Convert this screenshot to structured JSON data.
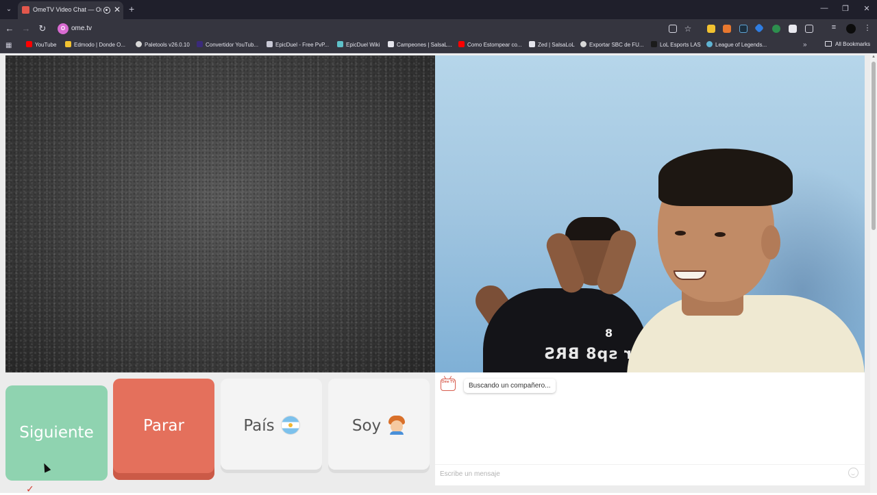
{
  "browser": {
    "tab_title": "OmeTV Video Chat — Ome",
    "tab_close": "✕",
    "new_tab": "+",
    "url": "ome.tv",
    "site_icon_letter": "O",
    "window": {
      "minimize": "—",
      "restore": "❐",
      "close": "✕"
    },
    "nav": {
      "back": "←",
      "forward": "→",
      "reload": "↻"
    }
  },
  "bookmarks": {
    "items": [
      {
        "label": "YouTube",
        "icon_color": "#ff0000"
      },
      {
        "label": "Edmodo | Donde O...",
        "icon_color": "#f2c230"
      },
      {
        "label": "Paletools v26.0.10",
        "icon_color": "#d8d8d8"
      },
      {
        "label": "Convertidor YouTub...",
        "icon_color": "#3a2a7a"
      },
      {
        "label": "EpicDuel - Free PvP...",
        "icon_color": "#c9c9d6"
      },
      {
        "label": "EpicDuel Wiki",
        "icon_color": "#5ec1c9"
      },
      {
        "label": "Campeones | SalsaL...",
        "icon_color": "#e4e4ec"
      },
      {
        "label": "Como Estompear co...",
        "icon_color": "#ff0000"
      },
      {
        "label": "Zed | SalsaLoL",
        "icon_color": "#e4e4ec"
      },
      {
        "label": "Exportar SBC de FU...",
        "icon_color": "#d8d8d8"
      },
      {
        "label": "LoL Esports LAS",
        "icon_color": "#1b1b1b"
      },
      {
        "label": "League of Legends...",
        "icon_color": "#5fb3d3"
      }
    ],
    "more": "»",
    "all_bookmarks": "All Bookmarks"
  },
  "controls": {
    "next_label": "Siguiente",
    "stop_label": "Parar",
    "country_label": "País",
    "gender_label": "Soy"
  },
  "chat": {
    "logo_text": "Ome TV",
    "status_message": "Buscando un compañero...",
    "input_placeholder": "Escribe un mensaje"
  },
  "video": {
    "partner_shirt_number": "8",
    "partner_shirt_text": "Br sp8 BRS"
  },
  "colors": {
    "next": "#8fd3b0",
    "stop": "#e4705c",
    "neutral": "#f4f4f4",
    "accent": "#d75b4c"
  }
}
